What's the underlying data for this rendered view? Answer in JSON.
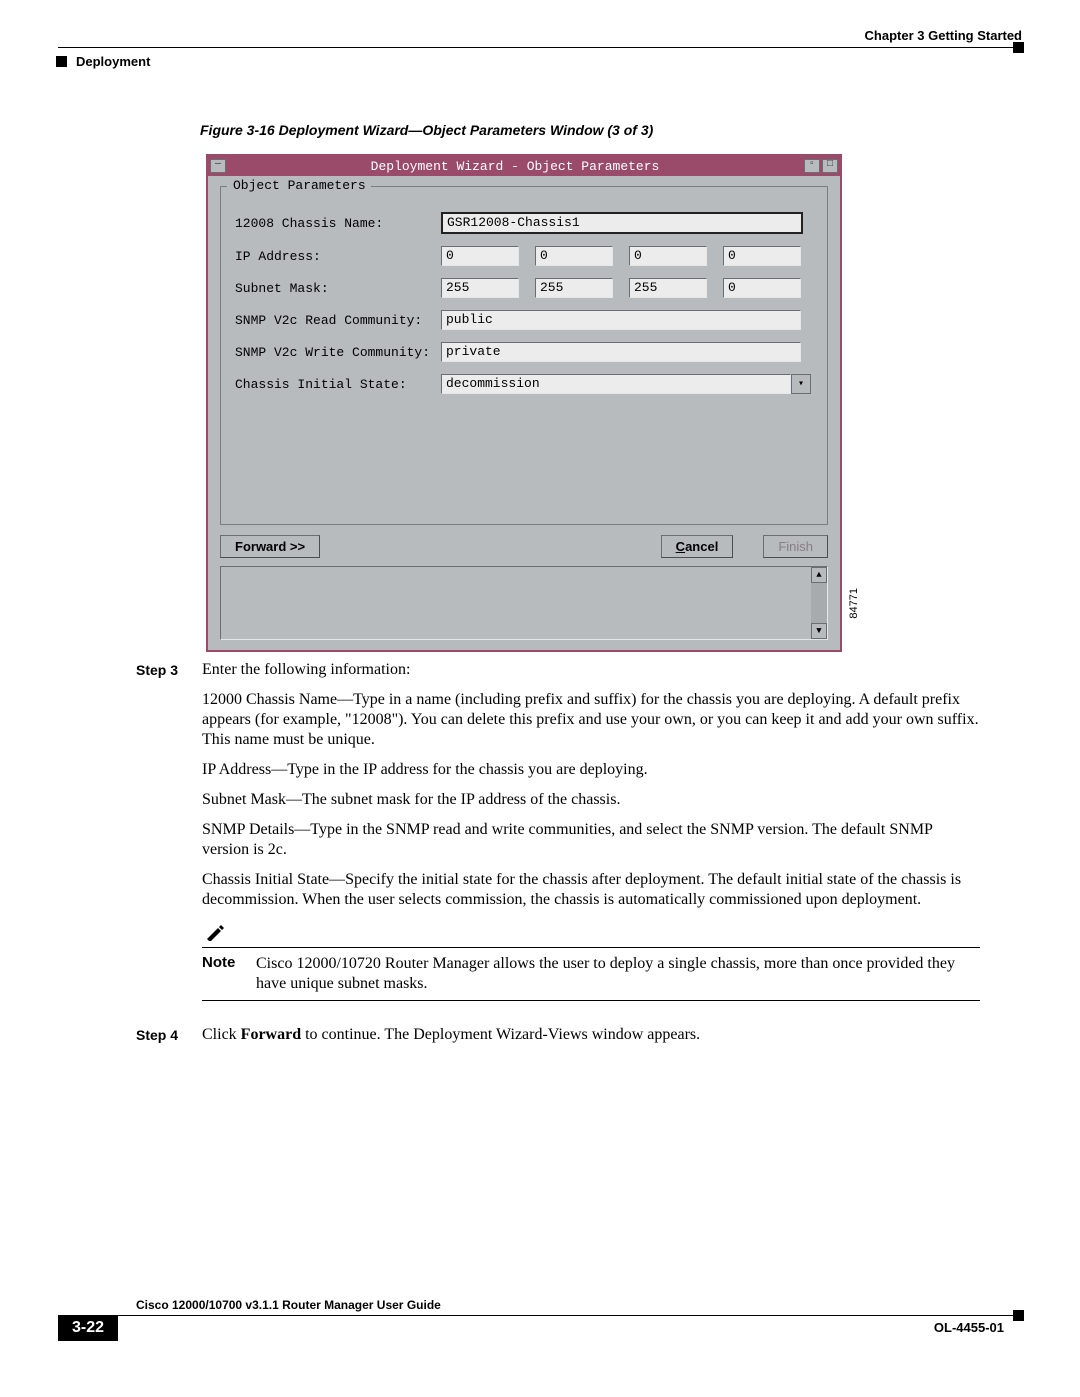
{
  "header": {
    "chapter": "Chapter 3      Getting Started",
    "section": "Deployment"
  },
  "figure_caption": "Figure 3-16   Deployment Wizard—Object Parameters Window (3 of 3)",
  "window": {
    "title": "Deployment Wizard - Object Parameters",
    "group_label": "Object Parameters",
    "fields": {
      "chassis_name": {
        "label": "12008 Chassis Name:",
        "value": "GSR12008-Chassis1"
      },
      "ip_address": {
        "label": "IP Address:",
        "v1": "0",
        "v2": "0",
        "v3": "0",
        "v4": "0"
      },
      "subnet_mask": {
        "label": "Subnet Mask:",
        "v1": "255",
        "v2": "255",
        "v3": "255",
        "v4": "0"
      },
      "snmp_read": {
        "label": "SNMP V2c Read Community:",
        "value": "public"
      },
      "snmp_write": {
        "label": "SNMP V2c Write Community:",
        "value": "private"
      },
      "initial_state": {
        "label": "Chassis Initial State:",
        "value": "decommission"
      }
    },
    "buttons": {
      "forward": "Forward >>",
      "cancel_pre": "C",
      "cancel_post": "ancel",
      "finish": "Finish"
    }
  },
  "image_id": "84771",
  "steps": {
    "step3": {
      "label": "Step 3",
      "intro": "Enter the following information:",
      "p1": "12000 Chassis Name—Type in a name (including prefix and suffix) for the chassis you are deploying. A default prefix appears (for example, \"12008\"). You can delete this prefix and use your own, or you can keep it and add your own suffix. This name must be unique.",
      "p2": "IP Address—Type in the IP address for the chassis you are deploying.",
      "p3": "Subnet Mask—The subnet mask for the IP address of the chassis.",
      "p4": "SNMP Details—Type in the SNMP read and write communities, and select the SNMP version. The default SNMP version is 2c.",
      "p5": "Chassis Initial State—Specify the initial state for the chassis after deployment. The default initial state of the chassis is decommission. When the user selects commission, the chassis is automatically commissioned upon deployment."
    },
    "note": {
      "label": "Note",
      "text": "Cisco 12000/10720 Router Manager allows the user to deploy a single chassis, more than once provided they have unique subnet masks."
    },
    "step4": {
      "label": "Step 4",
      "pre": "Click ",
      "bold": "Forward",
      "post": " to continue. The Deployment Wizard-Views window appears."
    }
  },
  "footer": {
    "guide": "Cisco 12000/10700 v3.1.1 Router Manager User Guide",
    "page": "3-22",
    "code": "OL-4455-01"
  }
}
